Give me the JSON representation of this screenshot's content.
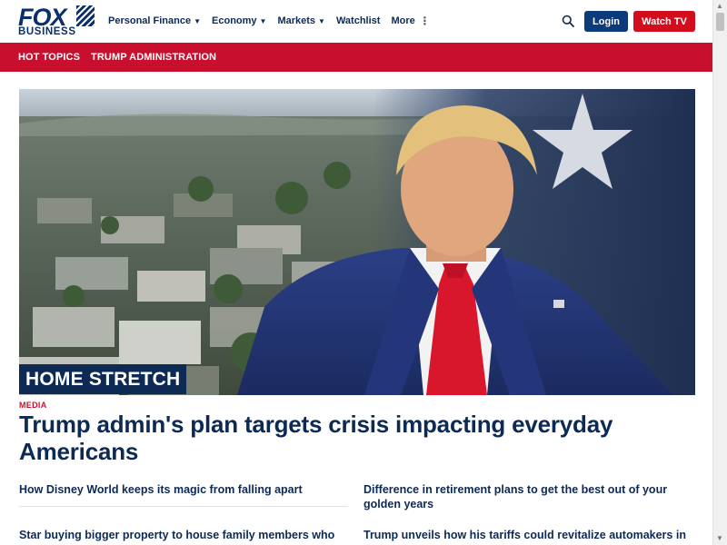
{
  "brand": {
    "logo_top": "FOX",
    "logo_bottom": "BUSINESS",
    "primary": "#0d2a54",
    "accent": "#c8102e"
  },
  "nav": {
    "items": [
      {
        "label": "Personal Finance",
        "has_dropdown": true
      },
      {
        "label": "Economy",
        "has_dropdown": true
      },
      {
        "label": "Markets",
        "has_dropdown": true
      },
      {
        "label": "Watchlist",
        "has_dropdown": false
      },
      {
        "label": "More",
        "has_dropdown": false
      }
    ],
    "more_icon": "kebab-icon",
    "search_icon": "search-icon",
    "login_label": "Login",
    "watch_label": "Watch TV"
  },
  "topics": {
    "items": [
      "HOT TOPICS",
      "TRUMP ADMINISTRATION"
    ]
  },
  "hero": {
    "kicker": "HOME STRETCH",
    "category": "MEDIA",
    "headline": "Trump admin's plan targets crisis impacting everyday Americans"
  },
  "stories": [
    "How Disney World keeps its magic from falling apart",
    "Difference in retirement plans to get the best out of your golden years",
    "Star buying bigger property to house family members who",
    "Trump unveils how his tariffs could revitalize automakers in"
  ]
}
